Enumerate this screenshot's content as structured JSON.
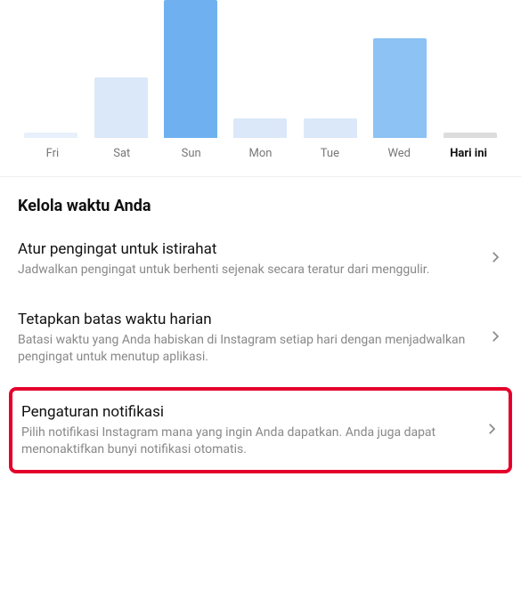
{
  "chart_data": {
    "type": "bar",
    "categories": [
      "Fri",
      "Sat",
      "Sun",
      "Mon",
      "Tue",
      "Wed",
      "Hari ini"
    ],
    "values": [
      6,
      68,
      155,
      22,
      22,
      112,
      6
    ],
    "colors": [
      "#e7f0fb",
      "#dbe8f9",
      "#6fb1f0",
      "#dbe8f9",
      "#dbe8f9",
      "#8cc2f4",
      "#dcdcdc"
    ],
    "title": "",
    "xlabel": "",
    "ylabel": "",
    "ylim": [
      0,
      155
    ]
  },
  "section": {
    "title": "Kelola waktu Anda"
  },
  "items": [
    {
      "title": "Atur pengingat untuk istirahat",
      "desc": "Jadwalkan pengingat untuk berhenti sejenak secara teratur dari menggulir."
    },
    {
      "title": "Tetapkan batas waktu harian",
      "desc": "Batasi waktu yang Anda habiskan di Instagram setiap hari dengan menjadwalkan pengingat untuk menutup aplikasi."
    },
    {
      "title": "Pengaturan notifikasi",
      "desc": "Pilih notifikasi Instagram mana yang ingin Anda dapatkan. Anda juga dapat menonaktifkan bunyi notifikasi otomatis."
    }
  ]
}
